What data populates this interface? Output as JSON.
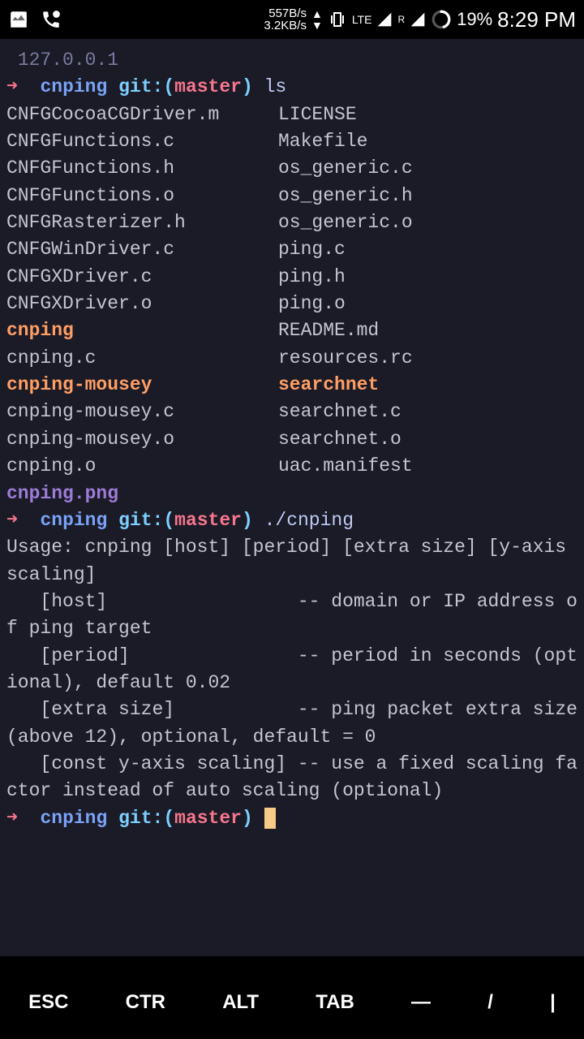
{
  "statusbar": {
    "speed_up": "557B/s",
    "speed_down": "3.2KB/s",
    "network": "LTE",
    "roaming": "R",
    "battery": "19%",
    "time": "8:29 PM"
  },
  "terminal": {
    "ip": " 127.0.0.1",
    "arrow": "➜",
    "dir": "cnping",
    "git_label": "git:",
    "paren_open": "(",
    "branch": "master",
    "paren_close": ")",
    "cmd_ls": "ls",
    "cmd_run": "./cnping",
    "files": {
      "r0c0": "CNFGCocoaCGDriver.m",
      "r0c1": "LICENSE",
      "r1c0": "CNFGFunctions.c",
      "r1c1": "Makefile",
      "r2c0": "CNFGFunctions.h",
      "r2c1": "os_generic.c",
      "r3c0": "CNFGFunctions.o",
      "r3c1": "os_generic.h",
      "r4c0": "CNFGRasterizer.h",
      "r4c1": "os_generic.o",
      "r5c0": "CNFGWinDriver.c",
      "r5c1": "ping.c",
      "r6c0": "CNFGXDriver.c",
      "r6c1": "ping.h",
      "r7c0": "CNFGXDriver.o",
      "r7c1": "ping.o",
      "r8c0": "cnping",
      "r8c1": "README.md",
      "r9c0": "cnping.c",
      "r9c1": "resources.rc",
      "r10c0": "cnping-mousey",
      "r10c1": "searchnet",
      "r11c0": "cnping-mousey.c",
      "r11c1": "searchnet.c",
      "r12c0": "cnping-mousey.o",
      "r12c1": "searchnet.o",
      "r13c0": "cnping.o",
      "r13c1": "uac.manifest",
      "r14c0": "cnping.png"
    },
    "usage": "Usage: cnping [host] [period] [extra size] [y-axis scaling]\n   [host]                 -- domain or IP address of ping target\n   [period]               -- period in seconds (optional), default 0.02\n   [extra size]           -- ping packet extra size (above 12), optional, default = 0\n   [const y-axis scaling] -- use a fixed scaling factor instead of auto scaling (optional)"
  },
  "bottombar": {
    "esc": "ESC",
    "ctr": "CTR",
    "alt": "ALT",
    "tab": "TAB",
    "dash": "—",
    "slash": "/",
    "pipe": "|"
  }
}
